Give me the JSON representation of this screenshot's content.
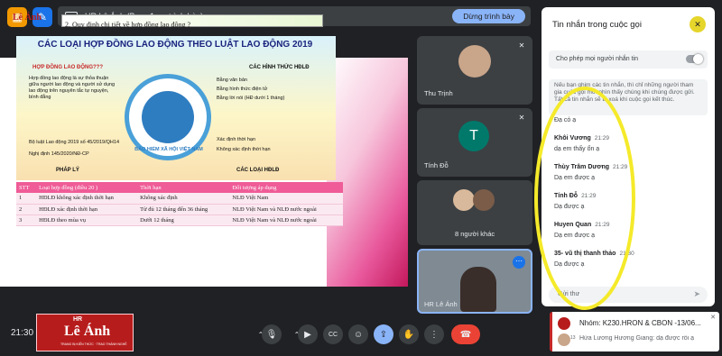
{
  "top": {
    "banner_title": "HR Lê Ánh (Bạn, đang trình bày)",
    "stop_presenting": "Dừng trình bày"
  },
  "slide": {
    "logo": "Lê Ánh",
    "heading": "2. Quy định chi tiết về hợp đồng lao động ?",
    "info_title": "CÁC LOẠI HỢP ĐỒNG LAO ĐỘNG THEO LUẬT LAO ĐỘNG 2019",
    "label_hdld": "HỢP ĐỒNG LAO ĐỘNG???",
    "text_hdld": "Hợp đồng lao động là sự thỏa thuận giữa người lao động và người sử dụng lao động trên nguyên tắc tự nguyện, bình đẳng",
    "label_hinhthuc": "CÁC HÌNH THỨC HĐLĐ",
    "hinhthuc": [
      "Bằng văn bản",
      "Bằng hình thức điện tử",
      "Bằng lời nói (HĐ dưới 1 tháng)"
    ],
    "phaply": [
      "Bộ luật Lao động 2019 số 45/2019/QH14",
      "Nghị định 145/2020/NĐ-CP"
    ],
    "label_phaply": "PHÁP LÝ",
    "loai": [
      "Xác định thời hạn",
      "Không xác định thời hạn"
    ],
    "label_loai": "CÁC LOẠI HĐLĐ",
    "emblem_text": "BẢO HIỂM XÃ HỘI VIỆT NAM",
    "table_headers": [
      "STT",
      "Loại hợp đồng (điều 20 )",
      "Thời hạn",
      "Đối tượng áp dụng"
    ],
    "table_rows": [
      [
        "1",
        "HĐLĐ không xác định thời hạn",
        "Không xác định",
        "NLĐ Việt Nam"
      ],
      [
        "2",
        "HĐLĐ xác định thời hạn",
        "Từ đủ 12 tháng đến 36 tháng",
        "NLĐ Việt Nam và NLĐ nước ngoài"
      ],
      [
        "3",
        "HĐLĐ theo mùa vụ",
        "Dưới 12 tháng",
        "NLĐ Việt Nam và NLĐ nước ngoài"
      ]
    ]
  },
  "tiles": {
    "thu": "Thu Trịnh",
    "tinh": "Tính Đỗ",
    "tinh_initial": "T",
    "others": "8 người khác",
    "self": "HR Lê Ánh"
  },
  "chat": {
    "title": "Tin nhắn trong cuộc gọi",
    "allow": "Cho phép mọi người nhắn tin",
    "notice": "Nếu bạn ghim các tin nhắn, thì chỉ những người tham gia cuộc gọi mới nhìn thấy chúng khi chúng được gửi. Tất cả tin nhắn sẽ bị xoá khi cuộc gọi kết thúc.",
    "partial": "Đạ có ạ",
    "messages": [
      {
        "who": "Khôi Vương",
        "time": "21:29",
        "body": "dạ em thấy ổn ạ"
      },
      {
        "who": "Thùy Trâm Dương",
        "time": "21:29",
        "body": "Dạ em được ạ"
      },
      {
        "who": "Tính Đỗ",
        "time": "21:29",
        "body": "Dạ được ạ"
      },
      {
        "who": "Huyen Quan",
        "time": "21:29",
        "body": "Dạ em được ạ"
      },
      {
        "who": "35- vũ thị thanh thảo",
        "time": "21:30",
        "body": "Dạ được ạ"
      }
    ],
    "input_placeholder": "Gửi thư"
  },
  "bottom": {
    "clock": "21:30",
    "logo_hr": "HR",
    "logo_name": "Lê Ánh",
    "logo_sub": "TRANG BỊ KIẾN THỨC · TRAO THÀNH NGHỀ",
    "badge": "13"
  },
  "notification": {
    "title": "Nhóm: K230.HRON & CBON -13/06...",
    "body": "Hứa Lương Hương Giang: dạ được rồi ạ"
  },
  "colors": {
    "accent": "#8ab4f8",
    "end_call": "#ea4335",
    "highlight": "#f5ea2a"
  }
}
